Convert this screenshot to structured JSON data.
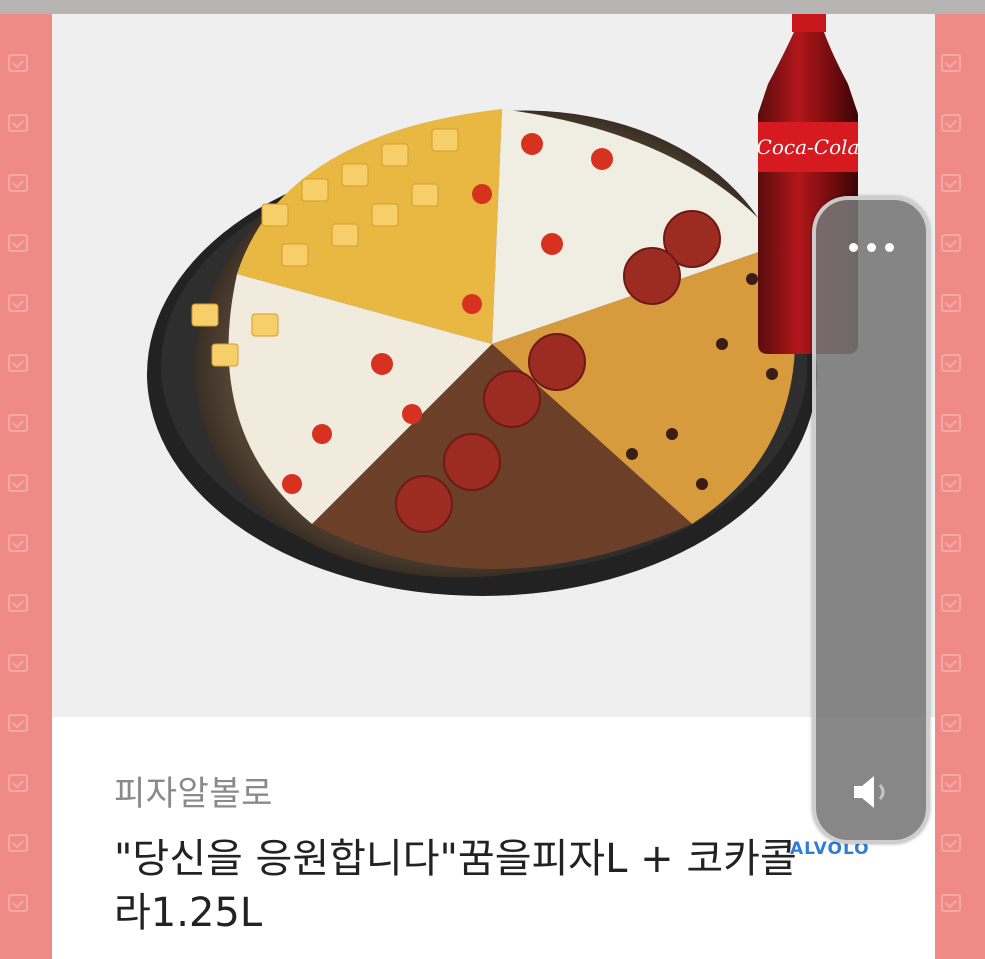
{
  "product": {
    "store_name": "피자알볼로",
    "title": "\"당신을 응원합니다\"꿈을피자L + 코카콜라1.25L",
    "bottle_label": "Coca-Cola",
    "brand_logo_text": "ALVOLO"
  },
  "overlay": {
    "more_icon": "more-horizontal-icon",
    "volume_icon": "speaker-icon"
  },
  "colors": {
    "background_pink": "#f08a86",
    "card": "#ffffff",
    "store_text": "#8a8a8a",
    "title_text": "#222222",
    "overlay_panel": "#767676"
  }
}
